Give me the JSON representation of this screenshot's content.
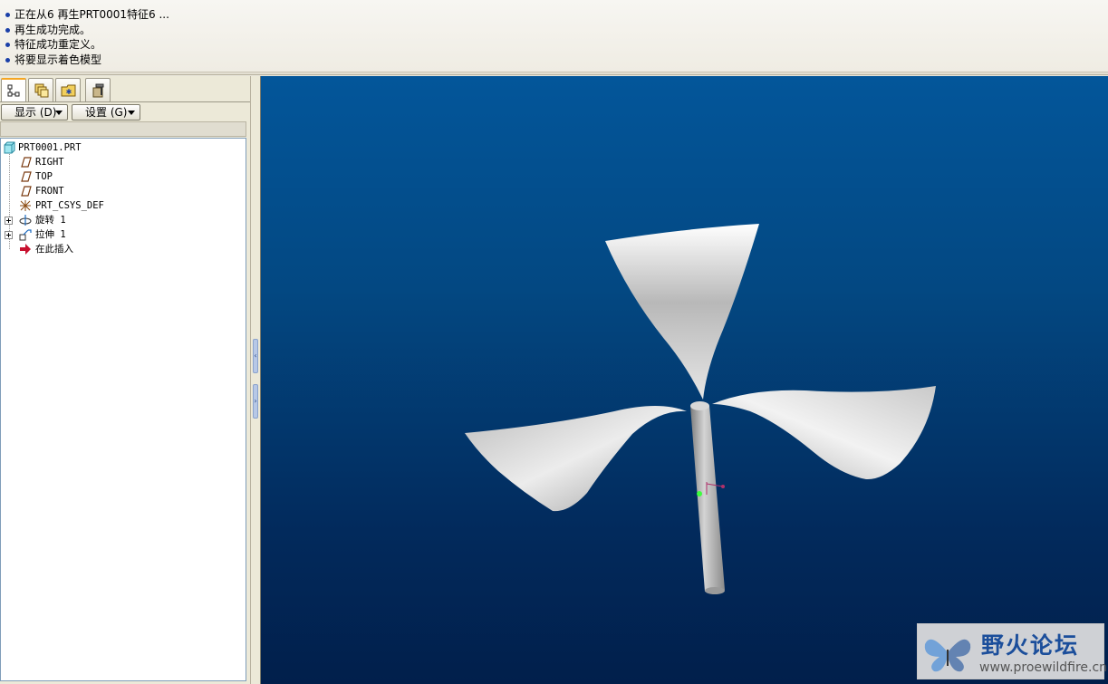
{
  "messages": [
    "正在从6 再生PRT0001特征6 ...",
    "再生成功完成。",
    "特征成功重定义。",
    "将要显示着色模型"
  ],
  "panel": {
    "tabs": [
      "model-tree-icon",
      "layers-icon",
      "folder-favorites-icon",
      "tools-icon"
    ],
    "show_label": "显示 (D)",
    "settings_label": "设置 (G)"
  },
  "tree": {
    "root": "PRT0001.PRT",
    "items": [
      {
        "label": "RIGHT",
        "icon": "datum-plane-icon"
      },
      {
        "label": "TOP",
        "icon": "datum-plane-icon"
      },
      {
        "label": "FRONT",
        "icon": "datum-plane-icon"
      },
      {
        "label": "PRT_CSYS_DEF",
        "icon": "csys-icon"
      },
      {
        "label": "旋转 1",
        "icon": "revolve-icon"
      },
      {
        "label": "拉伸 1",
        "icon": "extrude-icon"
      },
      {
        "label": "在此插入",
        "icon": "insert-here-arrow-icon"
      }
    ]
  },
  "watermark": {
    "title": "野火论坛",
    "url": "www.proewildfire.cn"
  },
  "colors": {
    "viewport_top": "#03569a",
    "viewport_bottom": "#011f4b",
    "model_surface": "#c8c8c8",
    "brand_blue": "#1b4e9b"
  }
}
